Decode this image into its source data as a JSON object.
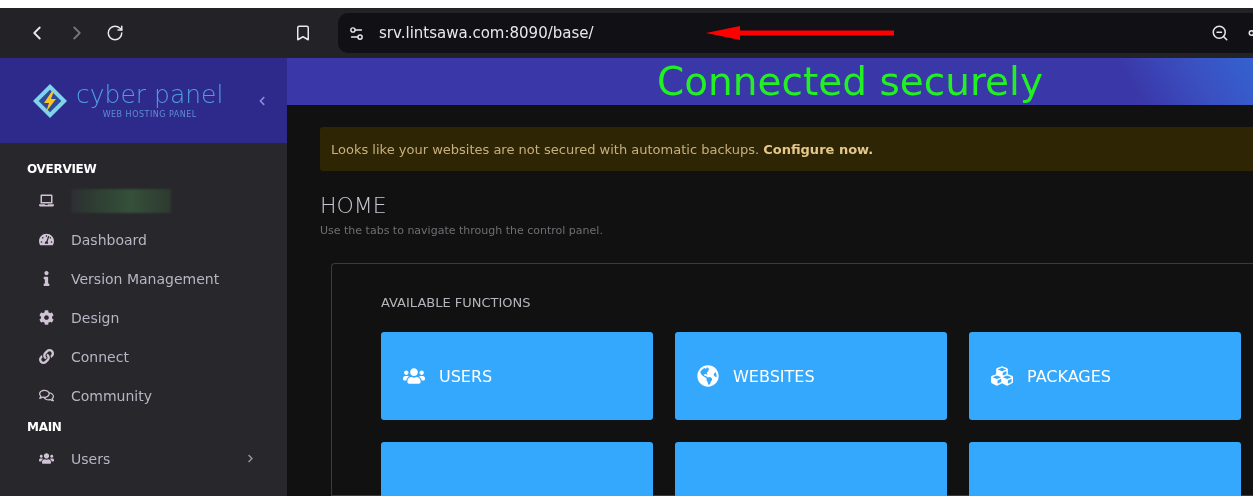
{
  "browser": {
    "url": "srv.lintsawa.com:8090/base/"
  },
  "sidebar": {
    "logo": {
      "name": "cyber panel",
      "tagline": "WEB HOSTING PANEL"
    },
    "sections": [
      {
        "title": "OVERVIEW",
        "items": [
          {
            "kind": "redacted",
            "has_submenu": false
          },
          {
            "kind": "link",
            "label": "Dashboard",
            "has_submenu": false
          },
          {
            "kind": "link",
            "label": "Version Management",
            "has_submenu": false
          },
          {
            "kind": "link",
            "label": "Design",
            "has_submenu": false
          },
          {
            "kind": "link",
            "label": "Connect",
            "has_submenu": false
          },
          {
            "kind": "link",
            "label": "Community",
            "has_submenu": false
          }
        ]
      },
      {
        "title": "MAIN",
        "items": [
          {
            "kind": "link",
            "label": "Users",
            "has_submenu": true
          }
        ]
      }
    ]
  },
  "banner": {
    "text": "Connected securely"
  },
  "alert": {
    "text": "Looks like your websites are not secured with automatic backups. **Configure now.**"
  },
  "page": {
    "title": "HOME",
    "subtitle": "Use the tabs to navigate through the control panel."
  },
  "functions": {
    "title": "AVAILABLE FUNCTIONS",
    "tiles": [
      {
        "label": "USERS"
      },
      {
        "label": "WEBSITES"
      },
      {
        "label": "PACKAGES"
      }
    ]
  }
}
